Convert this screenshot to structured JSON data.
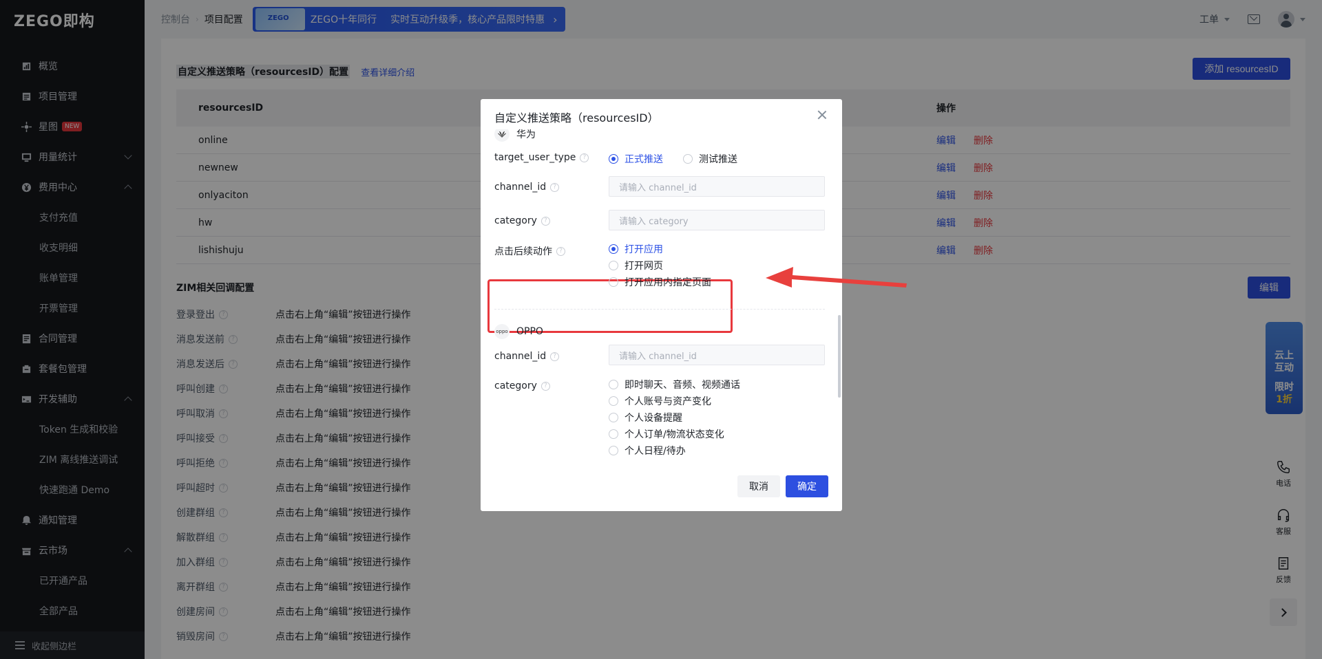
{
  "brand": {
    "logo": "ZEGO即构"
  },
  "sidebar": {
    "items": [
      {
        "label": "概览",
        "icon": "dashboard-icon",
        "type": "top"
      },
      {
        "label": "项目管理",
        "icon": "project-icon",
        "type": "top"
      },
      {
        "label": "星图",
        "icon": "star-map-icon",
        "type": "top",
        "badge": "NEW"
      },
      {
        "label": "用量统计",
        "icon": "usage-icon",
        "type": "top",
        "chevron": "down"
      },
      {
        "label": "费用中心",
        "icon": "yen-icon",
        "type": "top",
        "chevron": "up"
      },
      {
        "label": "支付充值",
        "type": "sub"
      },
      {
        "label": "收支明细",
        "type": "sub"
      },
      {
        "label": "账单管理",
        "type": "sub"
      },
      {
        "label": "开票管理",
        "type": "sub"
      },
      {
        "label": "合同管理",
        "icon": "contract-icon",
        "type": "top"
      },
      {
        "label": "套餐包管理",
        "icon": "package-icon",
        "type": "top"
      },
      {
        "label": "开发辅助",
        "icon": "dev-icon",
        "type": "top",
        "chevron": "up"
      },
      {
        "label": "Token 生成和校验",
        "type": "sub"
      },
      {
        "label": "ZIM 离线推送调试",
        "type": "sub"
      },
      {
        "label": "快速跑通 Demo",
        "type": "sub"
      },
      {
        "label": "通知管理",
        "icon": "bell-icon",
        "type": "top"
      },
      {
        "label": "云市场",
        "icon": "market-icon",
        "type": "top",
        "chevron": "up"
      },
      {
        "label": "已开通产品",
        "type": "sub"
      },
      {
        "label": "全部产品",
        "type": "sub"
      }
    ],
    "collapse_label": "收起侧边栏"
  },
  "header": {
    "breadcrumb": [
      "控制台",
      "项目配置"
    ],
    "promo_text_1": "ZEGO十年同行",
    "promo_text_2": "实时互动升级季，核心产品限时特惠",
    "promo_arrow": "›",
    "workorder": "工单"
  },
  "resources": {
    "title": "自定义推送策略（resourcesID）配置",
    "detail_link": "查看详细介绍",
    "add_button": "添加 resourcesID",
    "columns": [
      "resourcesID",
      "操作"
    ],
    "rows": [
      "online",
      "newnew",
      "onlyaciton",
      "hw",
      "lishishuju"
    ],
    "edit_label": "编辑",
    "delete_label": "删除"
  },
  "zim": {
    "title": "ZIM相关回调配置",
    "edit_button": "编辑",
    "rows": [
      {
        "label": "登录登出",
        "value": "点击右上角“编辑”按钮进行操作"
      },
      {
        "label": "消息发送前",
        "value": "点击右上角“编辑”按钮进行操作"
      },
      {
        "label": "消息发送后",
        "value": "点击右上角“编辑”按钮进行操作"
      },
      {
        "label": "呼叫创建",
        "value": "点击右上角“编辑”按钮进行操作"
      },
      {
        "label": "呼叫取消",
        "value": "点击右上角“编辑”按钮进行操作"
      },
      {
        "label": "呼叫接受",
        "value": "点击右上角“编辑”按钮进行操作"
      },
      {
        "label": "呼叫拒绝",
        "value": "点击右上角“编辑”按钮进行操作"
      },
      {
        "label": "呼叫超时",
        "value": "点击右上角“编辑”按钮进行操作"
      },
      {
        "label": "创建群组",
        "value": "点击右上角“编辑”按钮进行操作"
      },
      {
        "label": "解散群组",
        "value": "点击右上角“编辑”按钮进行操作"
      },
      {
        "label": "加入群组",
        "value": "点击右上角“编辑”按钮进行操作"
      },
      {
        "label": "离开群组",
        "value": "点击右上角“编辑”按钮进行操作"
      },
      {
        "label": "创建房间",
        "value": "点击右上角“编辑”按钮进行操作"
      },
      {
        "label": "销毁房间",
        "value": "点击右上角“编辑”按钮进行操作"
      }
    ]
  },
  "modal": {
    "title": "自定义推送策略（resourcesID）",
    "huawei": {
      "name": "华为",
      "target_user_type_label": "target_user_type",
      "target_options": [
        "正式推送",
        "测试推送"
      ],
      "target_selected": "正式推送",
      "channel_id_label": "channel_id",
      "channel_id_placeholder": "请输入 channel_id",
      "category_label": "category",
      "category_placeholder": "请输入 category",
      "click_action_label": "点击后续动作",
      "click_action_options": [
        "打开应用",
        "打开网页",
        "打开应用内指定页面"
      ],
      "click_action_selected": "打开应用"
    },
    "oppo": {
      "name": "OPPO",
      "logo_text": "oppo",
      "channel_id_label": "channel_id",
      "channel_id_placeholder": "请输入 channel_id",
      "category_label": "category",
      "category_options": [
        "即时聊天、音频、视频通话",
        "个人账号与资产变化",
        "个人设备提醒",
        "个人订单/物流状态变化",
        "个人日程/待办"
      ]
    },
    "cancel": "取消",
    "confirm": "确定"
  },
  "float_promo": {
    "line1": "云上",
    "line2": "互动",
    "line3": "限时",
    "line4": "1折"
  },
  "tools": [
    {
      "label": "电话",
      "icon": "phone-icon"
    },
    {
      "label": "客服",
      "icon": "headset-icon"
    },
    {
      "label": "反馈",
      "icon": "feedback-icon"
    }
  ],
  "colors": {
    "primary": "#2d4fe0",
    "danger": "#e8383d",
    "sidebar_bg": "#16181d"
  }
}
